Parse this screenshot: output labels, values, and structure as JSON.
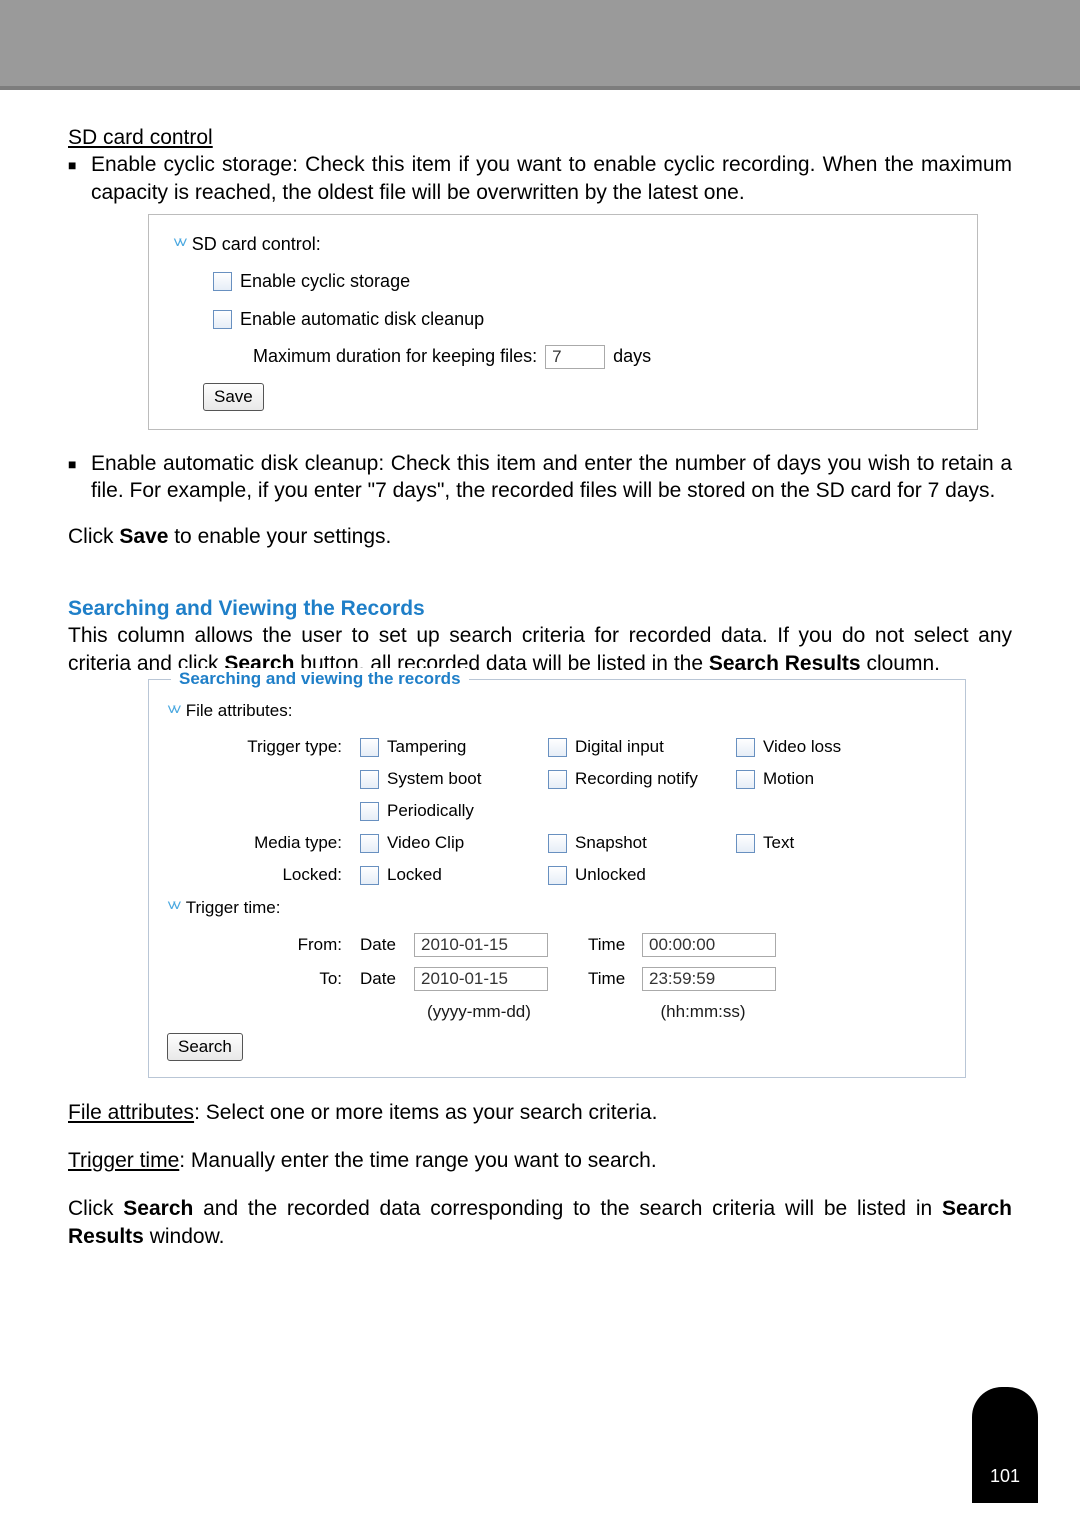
{
  "pageNumber": "101",
  "sd": {
    "title": "SD card control",
    "bullet1": "Enable cyclic storage: Check this item if you want to enable cyclic recording. When the maximum capacity is reached, the oldest file will be overwritten by the latest one.",
    "box": {
      "header": "SD card control:",
      "cbCyclic": "Enable cyclic storage",
      "cbCleanup": "Enable automatic disk cleanup",
      "maxDurLabel": "Maximum duration for keeping files:",
      "maxDurValue": "7",
      "maxDurUnit": "days",
      "saveBtn": "Save"
    },
    "bullet2": "Enable automatic disk cleanup: Check this item and enter the number of days you wish to retain a file. For example, if you enter \"7 days\", the recorded files will be stored on the SD card for 7 days.",
    "clickSave_pre": "Click ",
    "clickSave_bold": "Save",
    "clickSave_post": " to enable your settings."
  },
  "search": {
    "heading": "Searching and Viewing the Records",
    "intro_pre": "This column allows the user to set up search criteria for recorded data. If you do not select any criteria and click ",
    "intro_bold1": "Search",
    "intro_mid": " button, all recorded data will be listed in the ",
    "intro_bold2": "Search Results",
    "intro_post": " cloumn.",
    "box": {
      "legend": "Searching and viewing the records",
      "fileAttr": "File attributes:",
      "triggerTypeLabel": "Trigger type:",
      "tampering": "Tampering",
      "digitalInput": "Digital input",
      "videoLoss": "Video loss",
      "systemBoot": "System boot",
      "recordingNotify": "Recording notify",
      "motion": "Motion",
      "periodically": "Periodically",
      "mediaTypeLabel": "Media type:",
      "videoClip": "Video Clip",
      "snapshot": "Snapshot",
      "text": "Text",
      "lockedLabel": "Locked:",
      "locked": "Locked",
      "unlocked": "Unlocked",
      "triggerTime": "Trigger time:",
      "fromLabel": "From:",
      "toLabel": "To:",
      "dateWord": "Date",
      "timeWord": "Time",
      "fromDate": "2010-01-15",
      "fromTime": "00:00:00",
      "toDate": "2010-01-15",
      "toTime": "23:59:59",
      "dateFmt": "(yyyy-mm-dd)",
      "timeFmt": "(hh:mm:ss)",
      "searchBtn": "Search"
    },
    "fileAttrUnderline": "File attributes",
    "fileAttrRest": ": Select one or more items as your search criteria.",
    "triggerTimeUnderline": "Trigger time",
    "triggerTimeRest": ": Manually enter the time range you want to search.",
    "footer_pre": "Click ",
    "footer_b1": "Search",
    "footer_mid": " and the recorded data corresponding to the search criteria will be listed in ",
    "footer_b2": "Search Results",
    "footer_post": " window."
  }
}
